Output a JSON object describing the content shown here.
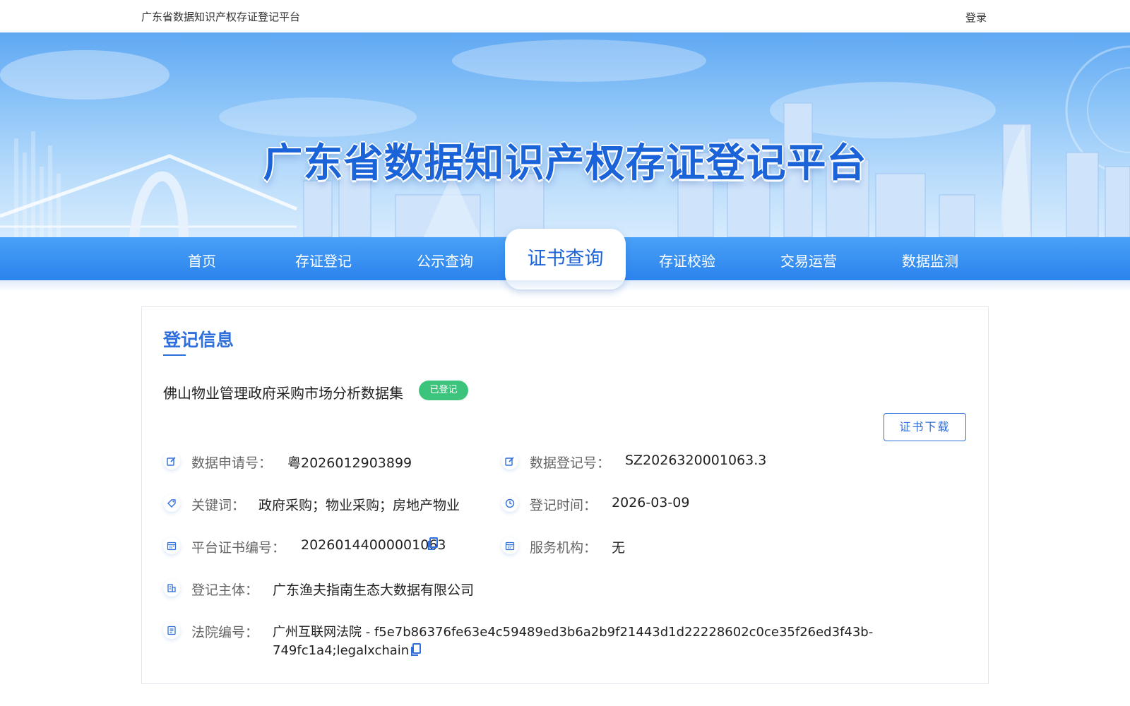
{
  "topbar": {
    "site_title": "广东省数据知识产权存证登记平台",
    "login": "登录"
  },
  "banner": {
    "title": "广东省数据知识产权存证登记平台"
  },
  "nav": {
    "items": [
      "首页",
      "存证登记",
      "公示查询",
      "证书查询",
      "存证校验",
      "交易运营",
      "数据监测"
    ],
    "active": "证书查询"
  },
  "card": {
    "section_title": "登记信息",
    "dataset_name": "佛山物业管理政府采购市场分析数据集",
    "status": "已登记",
    "download_button": "证书下载",
    "fields": {
      "apply_no_label": "数据申请号：",
      "apply_no": "粤2026012903899",
      "register_no_label": "数据登记号：",
      "register_no": "SZ2026320001063.3",
      "keywords_label": "关键词：",
      "keywords": "政府采购；物业采购；房地产物业",
      "register_time_label": "登记时间：",
      "register_time": "2026-03-09",
      "cert_no_label": "平台证书编号：",
      "cert_no": "20260144000001063",
      "service_org_label": "服务机构：",
      "service_org": "无",
      "subject_label": "登记主体：",
      "subject": "广东渔夫指南生态大数据有限公司",
      "court_no_label": "法院编号：",
      "court_no_line1": "广州互联网法院 - f5e7b86376fe63e4c59489ed3b6a2b9f21443d1d22228602c0ce35f26ed3f43b-",
      "court_no_line2": "749fc1a4;legalxchain"
    }
  },
  "colors": {
    "primary": "#2e6fdc",
    "nav_bg": "#2b83ee",
    "badge_green": "#3cc47c"
  },
  "icons": {
    "apply_no": "edit-icon",
    "register_no": "edit-icon",
    "keywords": "tag-icon",
    "register_time": "clock-icon",
    "cert_no": "calendar-icon",
    "service_org": "calendar-icon",
    "subject": "building-icon",
    "court_no": "document-icon",
    "copy": "copy-icon"
  }
}
